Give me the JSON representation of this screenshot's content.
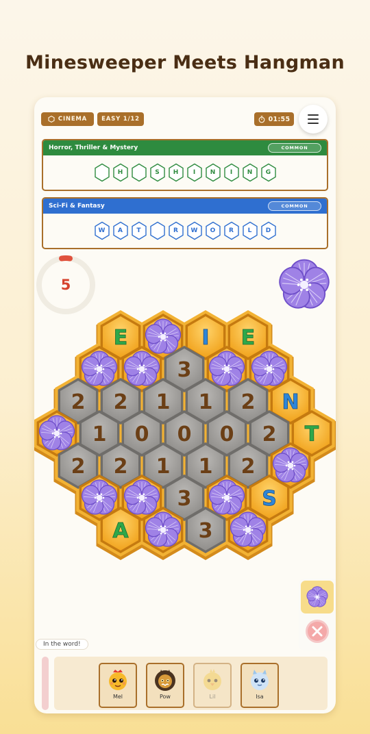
{
  "headline": "Minesweeper Meets Hangman",
  "topbar": {
    "category_chip": "CINEMA",
    "level_chip": "EASY 1/12",
    "timer": "01:55"
  },
  "puzzles": [
    {
      "title": "Horror, Thriller & Mystery",
      "rarity": "COMMON",
      "color": "#2e8b3f",
      "letters": [
        "",
        "H",
        "",
        "S",
        "H",
        "I",
        "N",
        "I",
        "N",
        "G"
      ]
    },
    {
      "title": "Sci-Fi & Fantasy",
      "rarity": "COMMON",
      "color": "#2f6fd0",
      "letters": [
        "W",
        "A",
        "T",
        "",
        "R",
        "W",
        "O",
        "R",
        "L",
        "D"
      ]
    }
  ],
  "lives": "5",
  "board": {
    "rows": [
      [
        "E",
        "*",
        "I",
        "E"
      ],
      [
        "*",
        "*",
        "3",
        "*",
        "*"
      ],
      [
        "2",
        "2",
        "1",
        "1",
        "2",
        "N"
      ],
      [
        "*",
        "1",
        "0",
        "0",
        "0",
        "2",
        "T"
      ],
      [
        "2",
        "2",
        "1",
        "1",
        "2",
        "*"
      ],
      [
        "*",
        "*",
        "3",
        "*",
        "S"
      ],
      [
        "A",
        "*",
        "3",
        "*"
      ]
    ],
    "letter_colors": {
      "E": "#2ea84a",
      "I": "#2e86d8",
      "N": "#2e86d8",
      "T": "#2ea84a",
      "S": "#2e86d8",
      "A": "#2ea84a"
    }
  },
  "hint_label": "In the word!",
  "characters": [
    {
      "name": "Mel",
      "dim": false
    },
    {
      "name": "Pow",
      "dim": false
    },
    {
      "name": "Lil",
      "dim": true
    },
    {
      "name": "Isa",
      "dim": false
    }
  ],
  "tools": {
    "flower_icon": "flower-icon",
    "clear_icon": "close-icon"
  }
}
